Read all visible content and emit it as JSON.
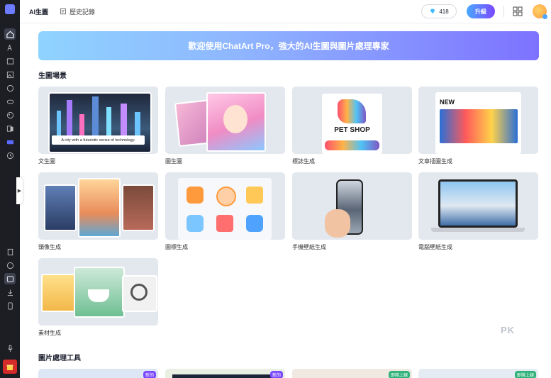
{
  "header": {
    "tab_main": "AI生圖",
    "tab_history": "歷史記錄",
    "credits": "418",
    "upgrade": "升級"
  },
  "banner": {
    "text": "歡迎使用ChatArt Pro，強大的AI生圖與圖片處理專家"
  },
  "sections": {
    "scenes_title": "生圖場景",
    "tools_title": "圖片處理工具"
  },
  "scenes": [
    {
      "label": "文生圖",
      "caption": "A city with a futuristic sense of technology."
    },
    {
      "label": "圖生圖"
    },
    {
      "label": "標誌生成",
      "caption": "PET SHOP"
    },
    {
      "label": "文章插圖生成",
      "caption": "NEW"
    },
    {
      "label": "頭像生成"
    },
    {
      "label": "圖標生成"
    },
    {
      "label": "手機壁紙生成"
    },
    {
      "label": "電腦壁紙生成"
    },
    {
      "label": "素材生成"
    }
  ],
  "tools": [
    {
      "badge": "新的"
    },
    {
      "badge": "新的"
    },
    {
      "badge": "即將上線"
    },
    {
      "badge": "即將上線"
    }
  ],
  "watermark": "PK",
  "colors": {
    "accent": "#7a48ff",
    "rail": "#1d1d24",
    "card": "#e3e7ee"
  }
}
